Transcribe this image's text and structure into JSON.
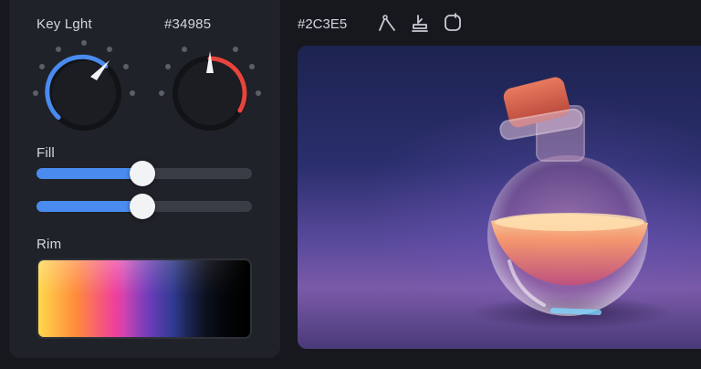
{
  "controls": {
    "knob_a": {
      "label": "Key Lght",
      "accent": "#4a8bf0"
    },
    "knob_b": {
      "label": "#34985",
      "accent": "#e6443d"
    },
    "fill": {
      "label": "Fill",
      "slider_1": 0.49,
      "slider_2": 0.49
    },
    "rim": {
      "label": "Rim"
    }
  },
  "toolbar": {
    "color_hex": "#2C3E5",
    "icons": [
      "pen-path-icon",
      "stamp-icon",
      "rounded-square-icon"
    ]
  },
  "preview": {
    "subject": "potion-bottle-image"
  },
  "colors": {
    "background": "#16181d",
    "panel": "#1f2228",
    "slider_track": "#3a3d45",
    "slider_fill": "#4a8bf0"
  }
}
